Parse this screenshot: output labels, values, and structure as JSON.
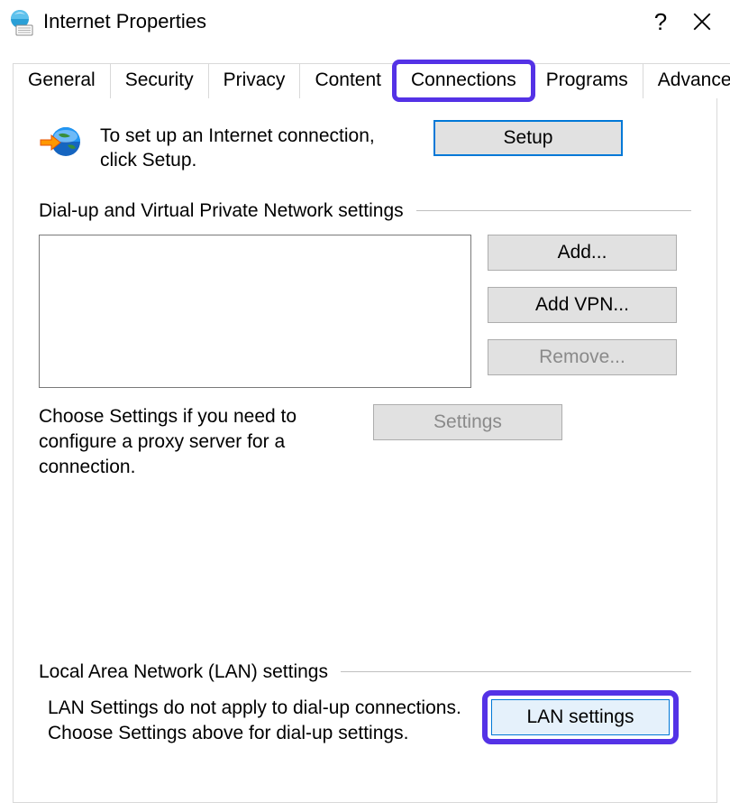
{
  "window": {
    "title": "Internet Properties",
    "help_label": "?",
    "close_label": "Close"
  },
  "tabs": {
    "general": "General",
    "security": "Security",
    "privacy": "Privacy",
    "content": "Content",
    "connections": "Connections",
    "programs": "Programs",
    "advanced": "Advanced",
    "active": "connections"
  },
  "setup": {
    "text": "To set up an Internet connection, click Setup.",
    "button": "Setup"
  },
  "dialup": {
    "title": "Dial-up and Virtual Private Network settings",
    "add": "Add...",
    "add_vpn": "Add VPN...",
    "remove": "Remove...",
    "settings": "Settings",
    "choose_text": "Choose Settings if you need to configure a proxy server for a connection."
  },
  "lan": {
    "title": "Local Area Network (LAN) settings",
    "text": "LAN Settings do not apply to dial-up connections. Choose Settings above for dial-up settings.",
    "button": "LAN settings"
  }
}
